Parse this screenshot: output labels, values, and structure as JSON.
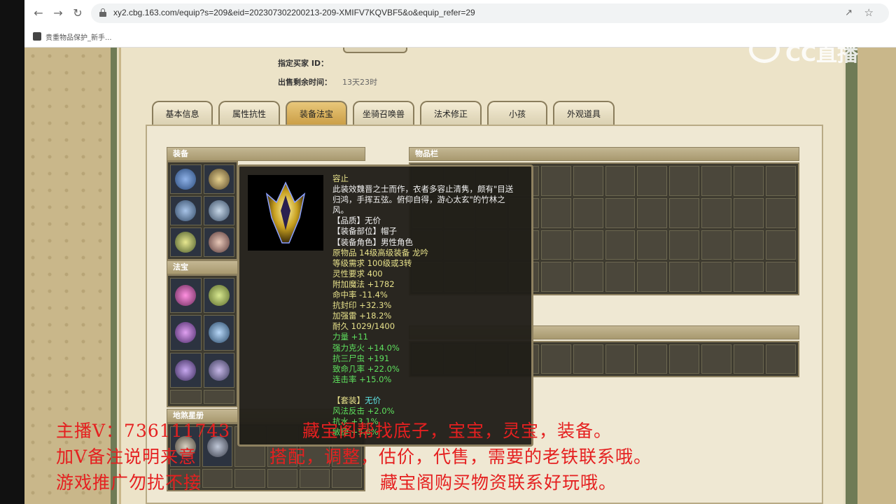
{
  "browser": {
    "url": "xy2.cbg.163.com/equip?s=209&eid=202307302200213-209-XMIFV7KQVBF5&o&equip_refer=29",
    "bookmark": "贵重物品保护_新手..."
  },
  "page": {
    "buyer_label": "指定买家 ID：",
    "time_label": "出售剩余时间：",
    "time_value": "13天23时"
  },
  "tabs": [
    "基本信息",
    "属性抗性",
    "装备法宝",
    "坐骑召唤兽",
    "法术修正",
    "小孩",
    "外观道具"
  ],
  "panels": {
    "equip": "装备",
    "fabao": "法宝",
    "dishaxingce": "地煞星册",
    "items": "物品栏"
  },
  "tooltip": {
    "name": "容止",
    "desc": [
      "此装效魏晋之士而作，衣者多容止清隽，颇有\"目送",
      "归鸿，手挥五弦。俯仰自得，游心太玄\"的竹林之",
      "风。"
    ],
    "quality_label": "【品质】无价",
    "slot_label": "【装备部位】帽子",
    "role_label": "【装备角色】男性角色",
    "origin": "原物品 14级高级装备 龙吟",
    "level_req": "等级需求 100级或3转",
    "spirit_req": "灵性要求 400",
    "stats": [
      "附加魔法 +1782",
      "命中率 -11.4%",
      "抗封印 +32.3%",
      "加强雷 +18.2%",
      "耐久 1029/1400"
    ],
    "green_stats": [
      "力量 +11",
      "强力克火 +14.0%",
      "抗三尸虫 +191",
      "致命几率 +22.0%",
      "连击率 +15.0%"
    ],
    "set_label": "【套装】",
    "set_value": "无价",
    "set_stats": [
      "风法反击 +2.0%",
      "抗水 +3.1%",
      "敏捷 +5.6%"
    ]
  },
  "overlay": {
    "line1a": "主播V：736111743",
    "line1b": "藏宝阁帮找底子，宝宝，灵宝，装备。",
    "line2a": "加V备注说明来意",
    "line2b": "搭配，调整，估价，代售，需要的老铁联系哦。",
    "line3a": "游戏推广勿扰不接",
    "line3b": "藏宝阁购买物资联系好玩哦。"
  },
  "watermark": "CC直播"
}
